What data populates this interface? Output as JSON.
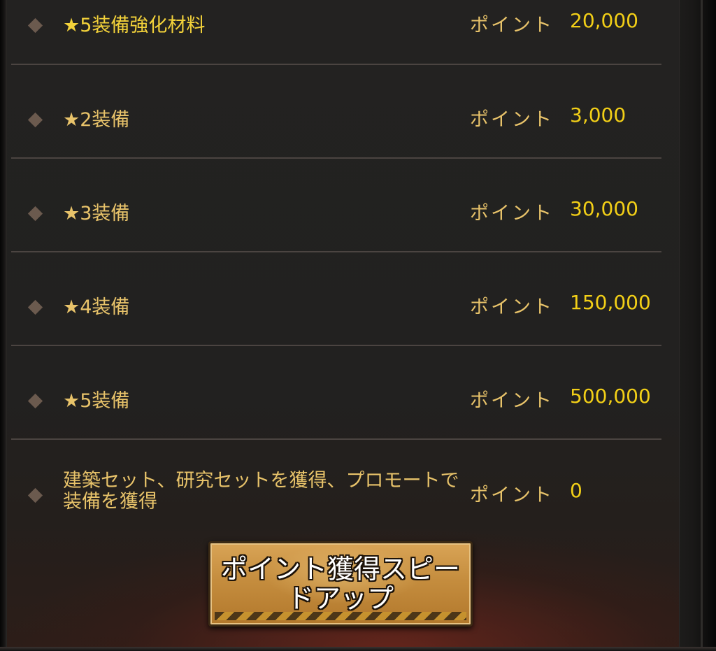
{
  "point_label": "ポイント",
  "rows": [
    {
      "label": "★5装備強化材料",
      "value": "20,000"
    },
    {
      "label": "★2装備",
      "value": "3,000"
    },
    {
      "label": "★3装備",
      "value": "30,000"
    },
    {
      "label": "★4装備",
      "value": "150,000"
    },
    {
      "label": "★5装備",
      "value": "500,000"
    },
    {
      "label": "建築セット、研究セットを獲得、プロモートで装備を獲得",
      "value": "0"
    }
  ],
  "speedup_button": {
    "label": "ポイント獲得スピードアップ"
  },
  "colors": {
    "label": "#e8c36a",
    "value": "#f2cf17",
    "divider": "#4b4441",
    "button": "#c58d3e"
  },
  "icons": {
    "row_bullet": "diamond-icon"
  }
}
